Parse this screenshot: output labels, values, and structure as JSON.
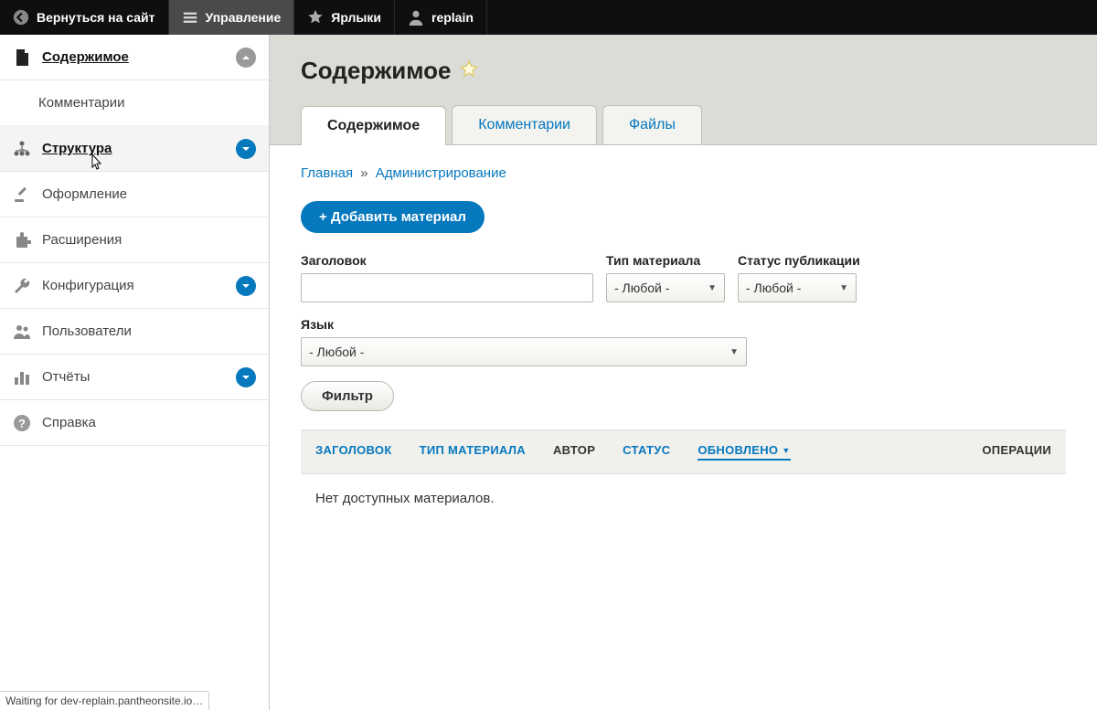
{
  "toolbar": {
    "back": "Вернуться на сайт",
    "manage": "Управление",
    "shortcuts": "Ярлыки",
    "user": "replain"
  },
  "sidebar": {
    "items": [
      {
        "label": "Содержимое",
        "kind": "content",
        "strong": true,
        "chev": "up"
      },
      {
        "label": "Комментарии",
        "kind": "sub"
      },
      {
        "label": "Структура",
        "kind": "structure",
        "strong": true,
        "chev": "blue",
        "hover": true
      },
      {
        "label": "Оформление",
        "kind": "appearance"
      },
      {
        "label": "Расширения",
        "kind": "extend"
      },
      {
        "label": "Конфигурация",
        "kind": "config",
        "chev": "blue"
      },
      {
        "label": "Пользователи",
        "kind": "people"
      },
      {
        "label": "Отчёты",
        "kind": "reports",
        "chev": "blue"
      },
      {
        "label": "Справка",
        "kind": "help"
      }
    ]
  },
  "page": {
    "title": "Содержимое",
    "tabs": [
      "Содержимое",
      "Комментарии",
      "Файлы"
    ],
    "breadcrumb": {
      "home": "Главная",
      "sep": "»",
      "admin": "Администрирование"
    },
    "add_button": "+ Добавить материал",
    "filters": {
      "title_label": "Заголовок",
      "type_label": "Тип материала",
      "status_label": "Статус публикации",
      "lang_label": "Язык",
      "any": "- Любой -",
      "filter_btn": "Фильтр"
    },
    "table": {
      "headers": [
        "ЗАГОЛОВОК",
        "ТИП МАТЕРИАЛА",
        "АВТОР",
        "СТАТУС",
        "ОБНОВЛЕНО",
        "ОПЕРАЦИИ"
      ],
      "empty": "Нет доступных материалов."
    }
  },
  "status_bar": "Waiting for dev-replain.pantheonsite.io…"
}
